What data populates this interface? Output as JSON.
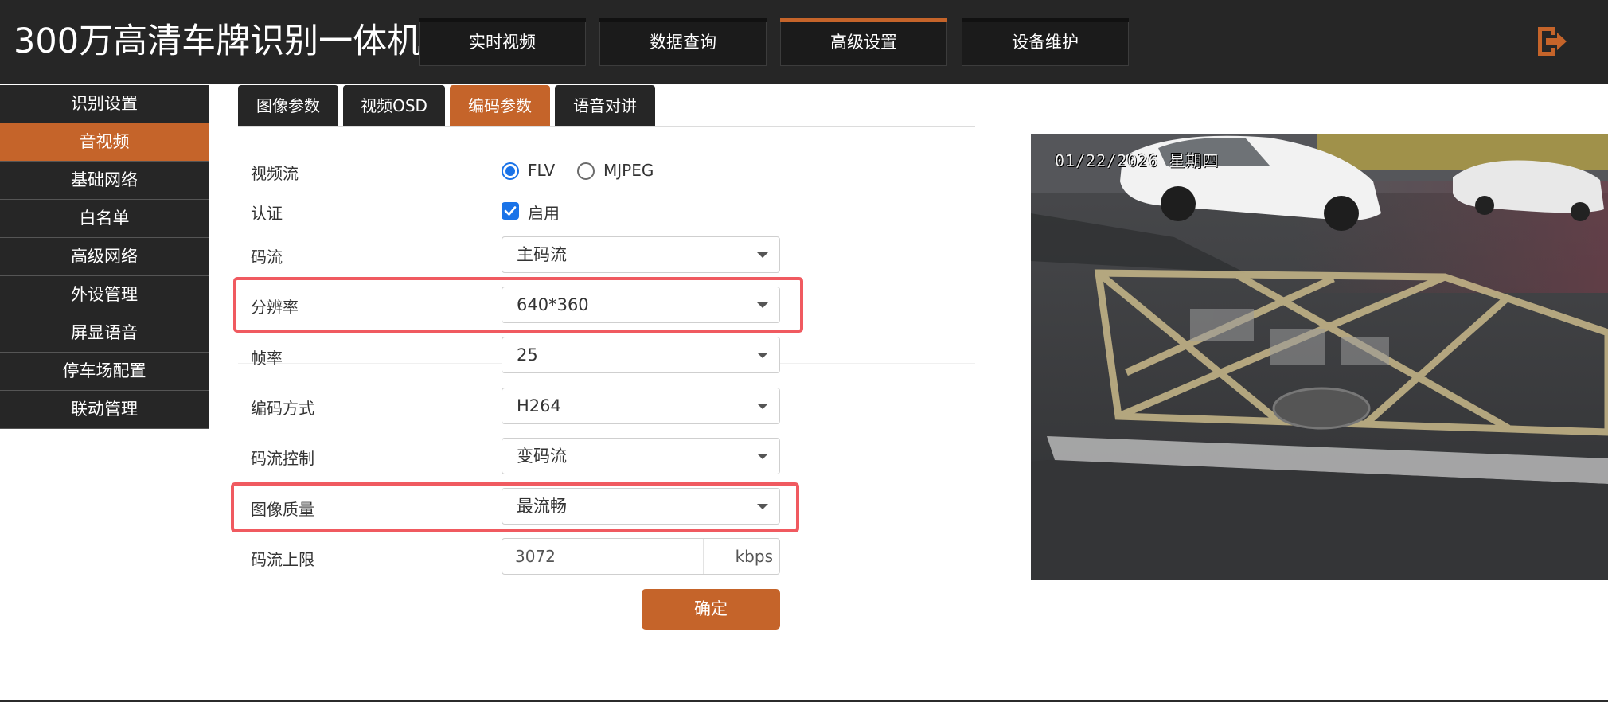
{
  "app": {
    "title": "300万高清车牌识别一体机"
  },
  "nav": {
    "tabs": [
      {
        "label": "实时视频"
      },
      {
        "label": "数据查询"
      },
      {
        "label": "高级设置",
        "active": true
      },
      {
        "label": "设备维护"
      }
    ],
    "logout_icon": "logout-icon"
  },
  "sidebar": {
    "items": [
      {
        "label": "识别设置"
      },
      {
        "label": "音视频",
        "active": true
      },
      {
        "label": "基础网络"
      },
      {
        "label": "白名单"
      },
      {
        "label": "高级网络"
      },
      {
        "label": "外设管理"
      },
      {
        "label": "屏显语音"
      },
      {
        "label": "停车场配置"
      },
      {
        "label": "联动管理"
      }
    ]
  },
  "subtabs": [
    {
      "label": "图像参数"
    },
    {
      "label": "视频OSD"
    },
    {
      "label": "编码参数",
      "active": true
    },
    {
      "label": "语音对讲"
    }
  ],
  "form": {
    "stream": {
      "label": "视频流",
      "options": [
        "FLV",
        "MJPEG"
      ],
      "selected": "FLV"
    },
    "auth": {
      "label": "认证",
      "checkbox_label": "启用",
      "checked": true
    },
    "code_stream": {
      "label": "码流",
      "value": "主码流"
    },
    "resolution": {
      "label": "分辨率",
      "value": "640*360"
    },
    "frame_rate": {
      "label": "帧率",
      "value": "25"
    },
    "encoding": {
      "label": "编码方式",
      "value": "H264"
    },
    "bitrate_control": {
      "label": "码流控制",
      "value": "变码流"
    },
    "image_quality": {
      "label": "图像质量",
      "value": "最流畅"
    },
    "bitrate_limit": {
      "label": "码流上限",
      "value": "3072",
      "unit": "kbps"
    },
    "confirm_label": "确定"
  },
  "video": {
    "timestamp": "01/22/2026 星期四"
  },
  "colors": {
    "accent": "#c5642a",
    "dark": "#262626",
    "highlight": "#f05a60",
    "check": "#1a73e8"
  }
}
